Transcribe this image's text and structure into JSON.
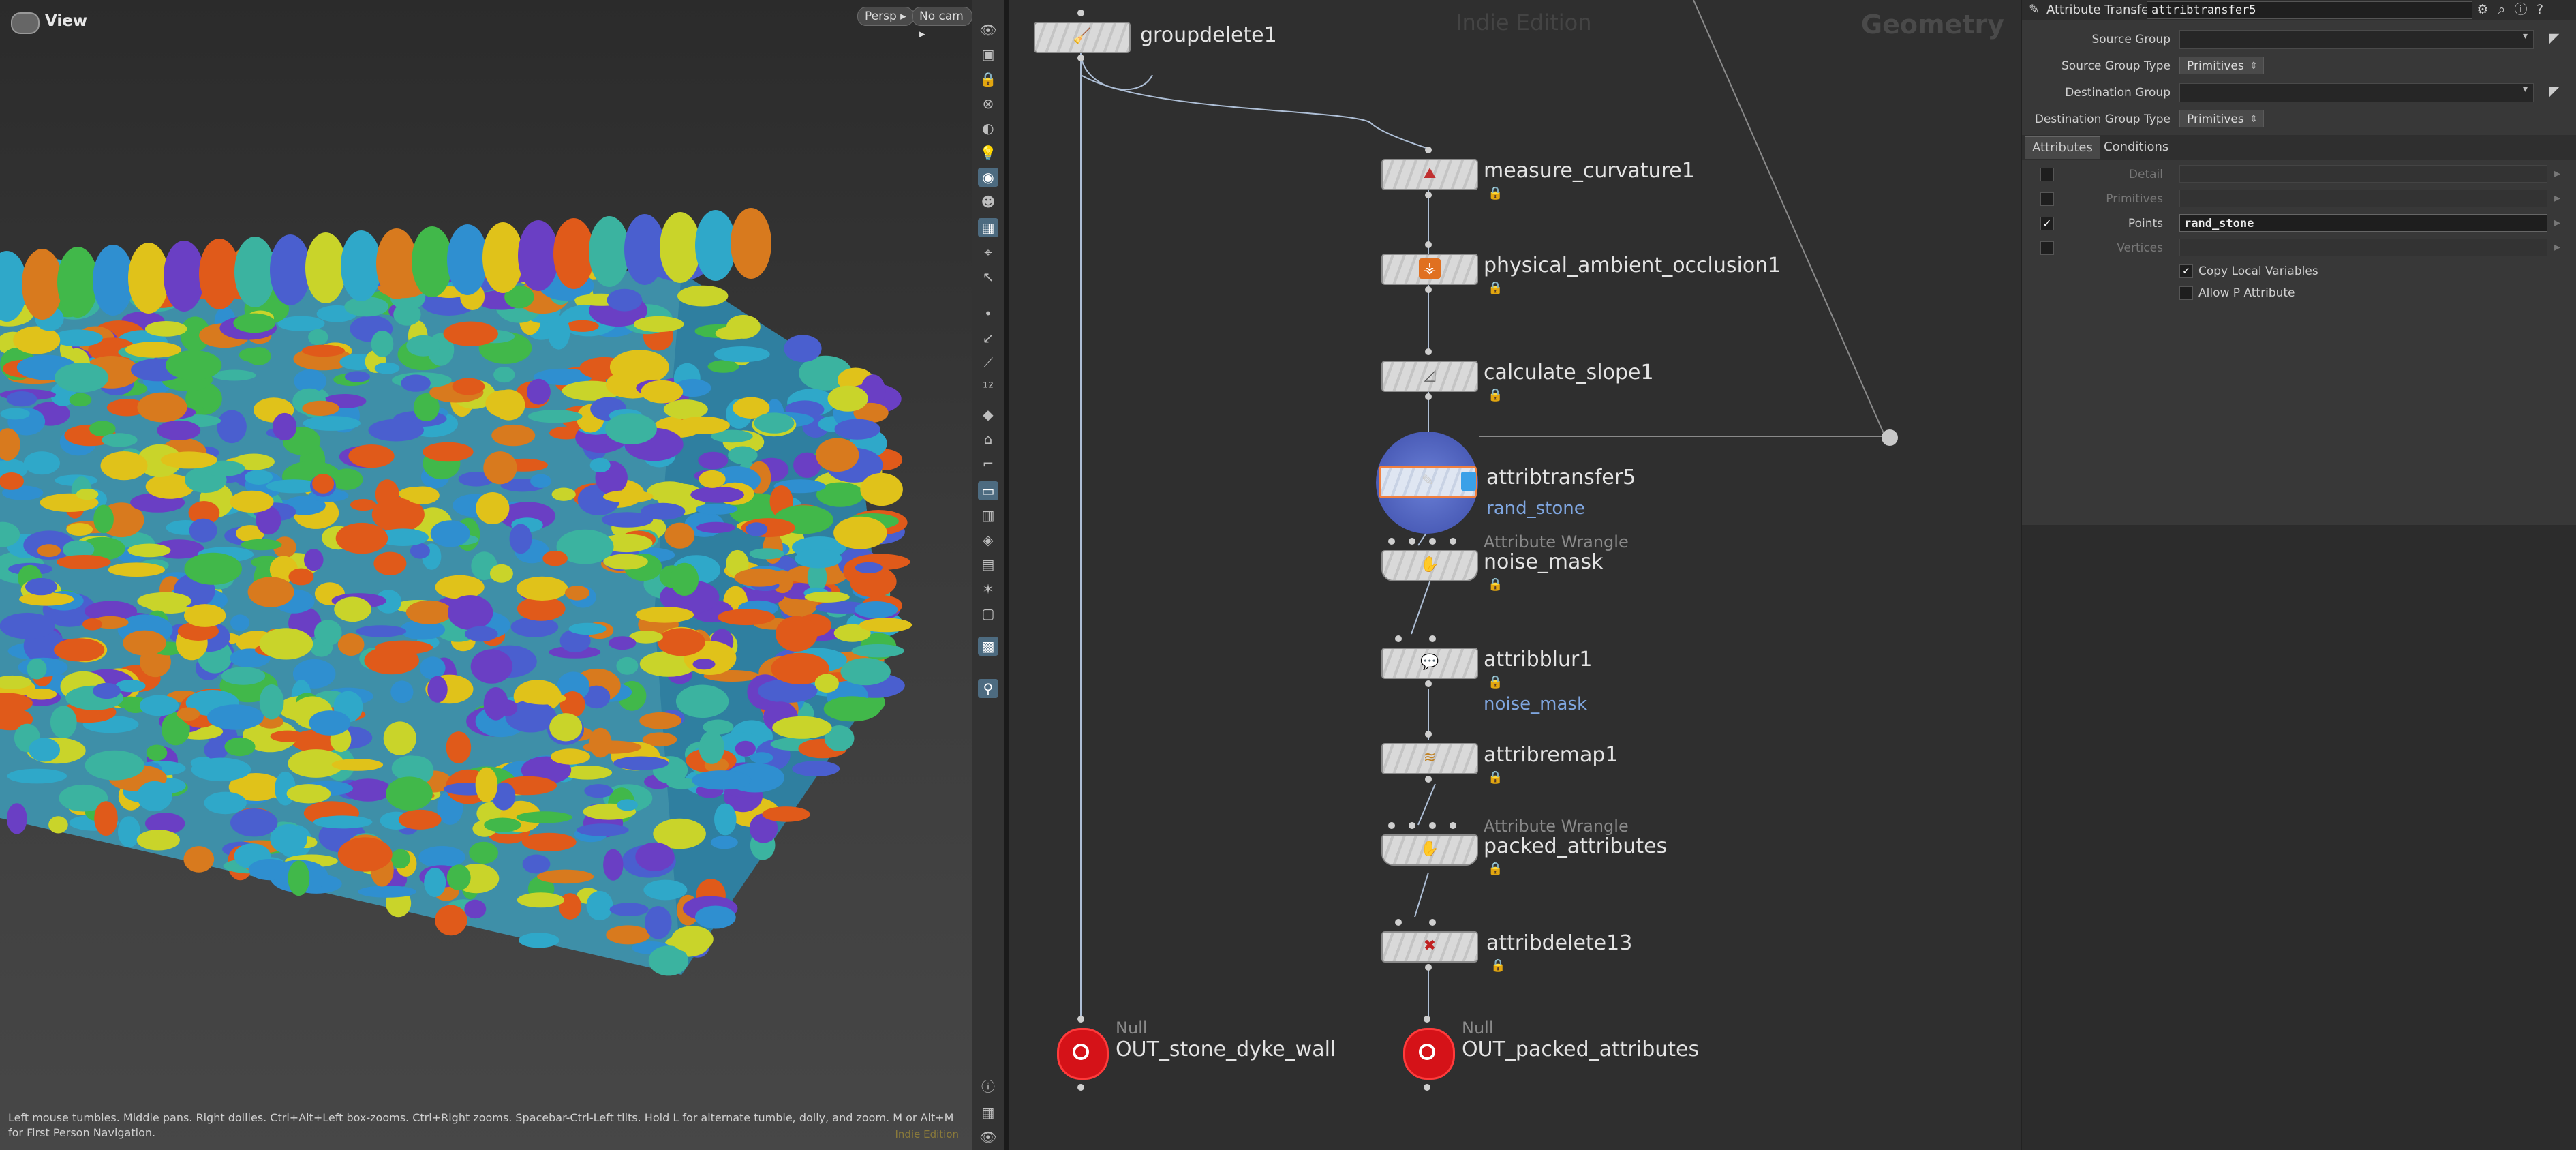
{
  "viewport": {
    "title": "View",
    "camera_mode": "Persp",
    "camera": "No cam",
    "status_text": "Left mouse tumbles. Middle pans. Right dollies. Ctrl+Alt+Left box-zooms. Ctrl+Right zooms. Spacebar-Ctrl-Left tilts. Hold L for alternate tumble, dolly, and zoom. M or Alt+M for First Person Navigation.",
    "edition": "Indie Edition"
  },
  "network": {
    "edition_watermark": "Indie Edition",
    "context": "Geometry",
    "nodes": [
      {
        "label": "groupdelete1",
        "icon": "groupdelete-icon"
      },
      {
        "label": "measure_curvature1",
        "icon": "measure-icon"
      },
      {
        "label": "physical_ambient_occlusion1",
        "icon": "occlusion-icon"
      },
      {
        "label": "calculate_slope1",
        "icon": "slope-icon"
      },
      {
        "label": "attribtransfer5",
        "sub": "rand_stone",
        "icon": "attribtransfer-icon"
      },
      {
        "label": "noise_mask",
        "type": "Attribute Wrangle",
        "icon": "wrangle-icon"
      },
      {
        "label": "attribblur1",
        "sub": "noise_mask",
        "icon": "blur-icon"
      },
      {
        "label": "attribremap1",
        "icon": "remap-icon"
      },
      {
        "label": "packed_attributes",
        "type": "Attribute Wrangle",
        "icon": "wrangle-icon"
      },
      {
        "label": "attribdelete13",
        "icon": "attribdelete-icon"
      },
      {
        "label": "OUT_stone_dyke_wall",
        "type": "Null"
      },
      {
        "label": "OUT_packed_attributes",
        "type": "Null"
      }
    ]
  },
  "params": {
    "node_type": "Attribute Transfer",
    "node_name": "attribtransfer5",
    "source_group_label": "Source Group",
    "source_group_type_label": "Source Group Type",
    "source_group_type_value": "Primitives",
    "destination_group_label": "Destination Group",
    "destination_group_type_label": "Destination Group Type",
    "destination_group_type_value": "Primitives",
    "tabs": [
      "Attributes",
      "Conditions"
    ],
    "attributes": [
      {
        "label": "Detail",
        "checked": false,
        "value": ""
      },
      {
        "label": "Primitives",
        "checked": false,
        "value": ""
      },
      {
        "label": "Points",
        "checked": true,
        "value": "rand_stone"
      },
      {
        "label": "Vertices",
        "checked": false,
        "value": ""
      }
    ],
    "copy_local_variables": "Copy Local Variables",
    "allow_p_attribute": "Allow P Attribute",
    "check_mark": "✓"
  },
  "colors": {
    "accent": "#7fa6e0",
    "selection": "#5b6fcf",
    "null_red": "#d51218"
  }
}
